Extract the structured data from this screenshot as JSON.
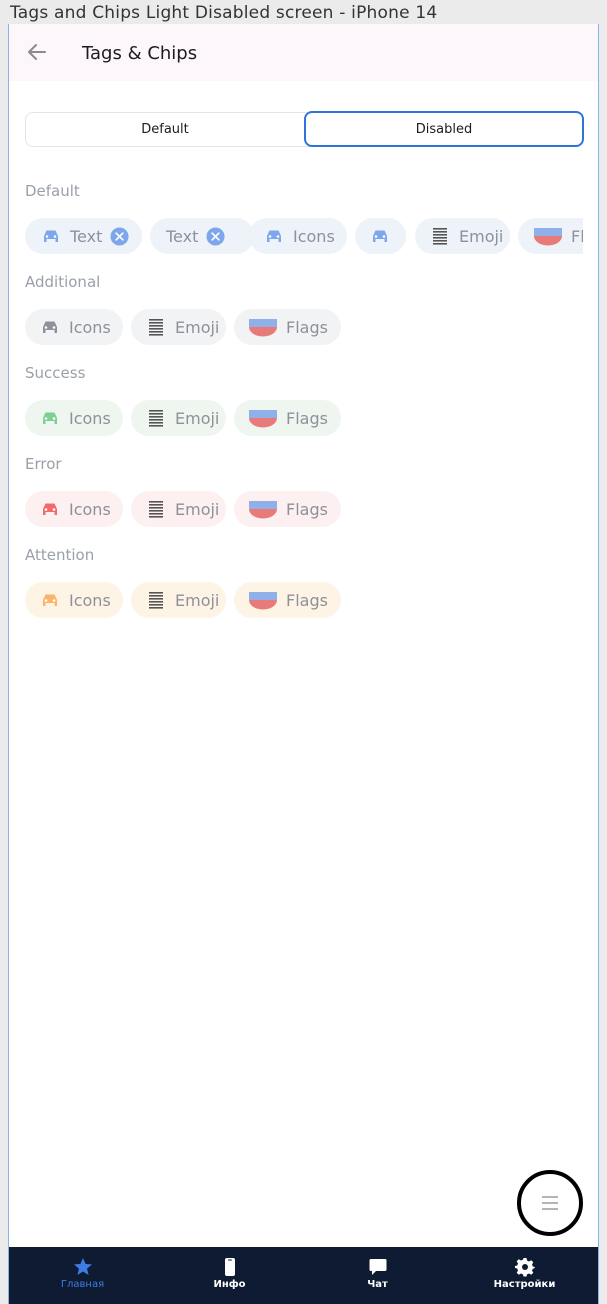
{
  "caption": "Tags and Chips Light Disabled screen - iPhone 14",
  "header": {
    "title": "Tags & Chips",
    "back_icon": "arrow-left-icon"
  },
  "segmented": {
    "options": [
      "Default",
      "Disabled"
    ],
    "selected": "Disabled"
  },
  "sections": {
    "default": {
      "title": "Default",
      "chips": {
        "text1": "Text",
        "text2": "Text",
        "icons": "Icons",
        "emoji": "Emoji",
        "flags": "Fl"
      }
    },
    "additional": {
      "title": "Additional",
      "chips": {
        "icons": "Icons",
        "emoji": "Emoji",
        "flags": "Flags"
      }
    },
    "success": {
      "title": "Success",
      "chips": {
        "icons": "Icons",
        "emoji": "Emoji",
        "flags": "Flags"
      }
    },
    "error": {
      "title": "Error",
      "chips": {
        "icons": "Icons",
        "emoji": "Emoji",
        "flags": "Flags"
      }
    },
    "attention": {
      "title": "Attention",
      "chips": {
        "icons": "Icons",
        "emoji": "Emoji",
        "flags": "Flags"
      }
    }
  },
  "colors": {
    "accent": "#2f74de",
    "default_icon": "#7ea6ea",
    "additional_icon": "#8e9199",
    "success_icon": "#7dcf93",
    "error_icon": "#f06b6b",
    "attention_icon": "#f8b56a",
    "tabbar_bg": "#0f1a33"
  },
  "fab": {
    "icon": "menu-icon"
  },
  "tabbar": {
    "items": [
      {
        "label": "Главная",
        "icon": "star-icon",
        "active": true
      },
      {
        "label": "Инфо",
        "icon": "phone-icon",
        "active": false
      },
      {
        "label": "Чат",
        "icon": "chat-icon",
        "active": false
      },
      {
        "label": "Настройки",
        "icon": "gear-icon",
        "active": false
      }
    ]
  }
}
